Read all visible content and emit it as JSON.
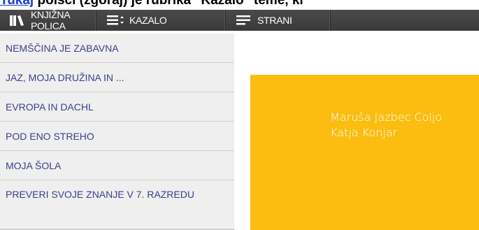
{
  "caption": {
    "link_text": "Tukaj",
    "text": " poišči (zgoraj) je rubrika \"Kazalo\" teme, ki"
  },
  "toolbar": {
    "books_label": "KNJIŽNA POLICA",
    "index_label": "KAZALO",
    "pages_label": "STRANI",
    "icons": [
      "bookshelf-icon",
      "list-dropdown-icon",
      "pages-icon"
    ]
  },
  "sidebar": {
    "items": [
      {
        "label": "NEMŠČINA JE ZABAVNA"
      },
      {
        "label": "JAZ, MOJA DRUŽINA IN ..."
      },
      {
        "label": "EVROPA IN DACHL"
      },
      {
        "label": "POD ENO STREHO"
      },
      {
        "label": "MOJA ŠOLA"
      },
      {
        "label": "PREVERI SVOJE ZNANJE V 7. RAZREDU"
      }
    ]
  },
  "cover": {
    "authors": [
      "Maruša Jazbec Coljo",
      "Katja Konjar"
    ],
    "background": "#fbbd0f"
  },
  "colors": {
    "toolbar": "#3f3f3f",
    "sidebar_text": "#3a3f8a",
    "link": "#1a3fd6"
  }
}
